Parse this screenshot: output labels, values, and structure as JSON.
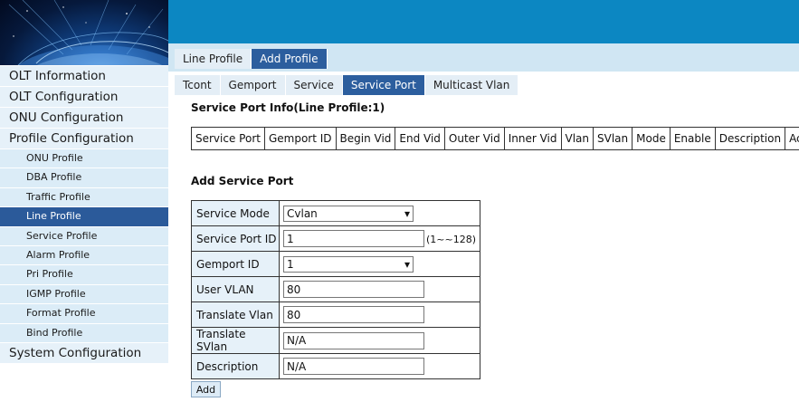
{
  "sidebar": {
    "items": [
      {
        "label": "OLT Information"
      },
      {
        "label": "OLT Configuration"
      },
      {
        "label": "ONU Configuration"
      },
      {
        "label": "Profile Configuration"
      }
    ],
    "sub_items": [
      {
        "label": "ONU Profile"
      },
      {
        "label": "DBA Profile"
      },
      {
        "label": "Traffic Profile"
      },
      {
        "label": "Line Profile"
      },
      {
        "label": "Service Profile"
      },
      {
        "label": "Alarm Profile"
      },
      {
        "label": "Pri Profile"
      },
      {
        "label": "IGMP Profile"
      },
      {
        "label": "Format Profile"
      },
      {
        "label": "Bind Profile"
      }
    ],
    "last_item": "System Configuration"
  },
  "top_tabs": [
    "Line Profile",
    "Add Profile"
  ],
  "sub_tabs": [
    "Tcont",
    "Gemport",
    "Service",
    "Service Port",
    "Multicast Vlan"
  ],
  "info": {
    "title": "Service Port Info(Line Profile:1)",
    "columns": [
      "Service Port",
      "Gemport ID",
      "Begin Vid",
      "End Vid",
      "Outer Vid",
      "Inner Vid",
      "Vlan",
      "SVlan",
      "Mode",
      "Enable",
      "Description",
      "Action"
    ]
  },
  "form": {
    "title": "Add Service Port",
    "fields": [
      {
        "label": "Service Mode",
        "value": "Cvlan"
      },
      {
        "label": "Service Port ID",
        "value": "1",
        "hint": "(1~~128)"
      },
      {
        "label": "Gemport ID",
        "value": "1"
      },
      {
        "label": "User VLAN",
        "value": "80"
      },
      {
        "label": "Translate Vlan",
        "value": "80"
      },
      {
        "label": "Translate SVlan",
        "value": "N/A"
      },
      {
        "label": "Description",
        "value": "N/A"
      }
    ],
    "add_label": "Add"
  }
}
